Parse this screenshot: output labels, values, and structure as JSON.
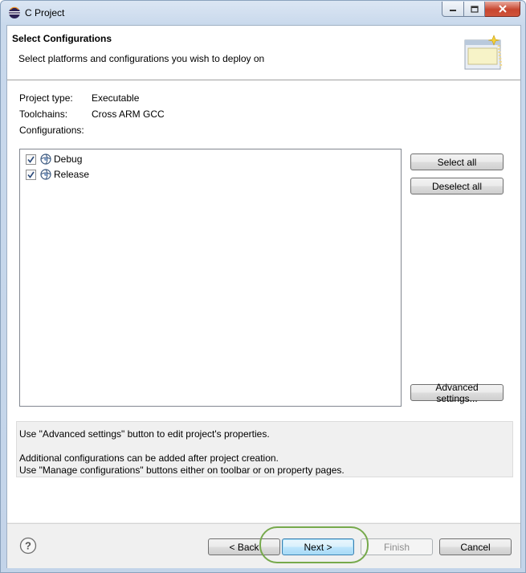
{
  "window": {
    "title": "C Project",
    "icon": "eclipse-icon",
    "controls": [
      "minimize-icon",
      "maximize-icon",
      "close-icon"
    ],
    "close_color": "#c7462f"
  },
  "header": {
    "title": "Select Configurations",
    "description": "Select platforms and configurations you wish to deploy on",
    "image": "wizard-banner-icon"
  },
  "details": {
    "project_type_label": "Project type:",
    "project_type_value": "Executable",
    "toolchains_label": "Toolchains:",
    "toolchains_value": "Cross ARM GCC",
    "configurations_label": "Configurations:"
  },
  "configurations": [
    {
      "label": "Debug",
      "checked": true,
      "icon": "configuration-icon"
    },
    {
      "label": "Release",
      "checked": true,
      "icon": "configuration-icon"
    }
  ],
  "side_buttons": {
    "select_all": "Select all",
    "deselect_all": "Deselect all",
    "advanced": "Advanced settings..."
  },
  "info": {
    "line1": "Use \"Advanced settings\" button to edit project's properties.",
    "line2": "Additional configurations can be added after project creation.",
    "line3": "Use \"Manage configurations\" buttons either on toolbar or on property pages."
  },
  "footer": {
    "help_icon": "help-icon",
    "back": "< Back",
    "next": "Next >",
    "finish": "Finish",
    "cancel": "Cancel",
    "highlight_color": "#76a94c"
  }
}
